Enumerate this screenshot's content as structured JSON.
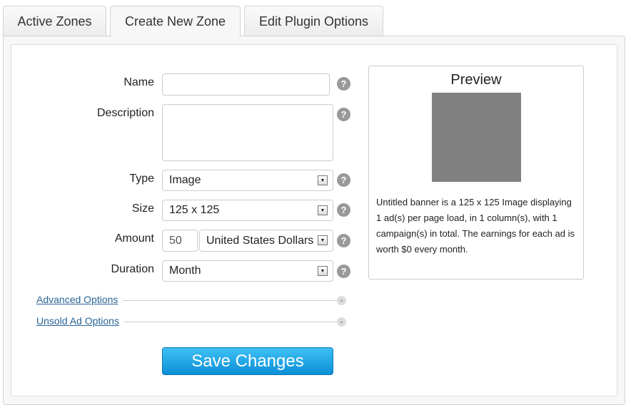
{
  "tabs": [
    {
      "label": "Active Zones"
    },
    {
      "label": "Create New Zone"
    },
    {
      "label": "Edit Plugin Options"
    }
  ],
  "form": {
    "name_label": "Name",
    "name_value": "",
    "description_label": "Description",
    "description_value": "",
    "type_label": "Type",
    "type_value": "Image",
    "size_label": "Size",
    "size_value": "125 x 125",
    "amount_label": "Amount",
    "amount_value": "50",
    "currency_value": "United States Dollars",
    "duration_label": "Duration",
    "duration_value": "Month",
    "help_glyph": "?",
    "advanced_options": "Advanced Options",
    "unsold_options": "Unsold Ad Options",
    "save_label": "Save Changes"
  },
  "preview": {
    "title": "Preview",
    "banner_color": "#808080",
    "description": "Untitled banner is a 125 x 125 Image displaying 1 ad(s) per page load, in 1 column(s), with 1 campaign(s) in total. The earnings for each ad is worth $0 every month."
  }
}
